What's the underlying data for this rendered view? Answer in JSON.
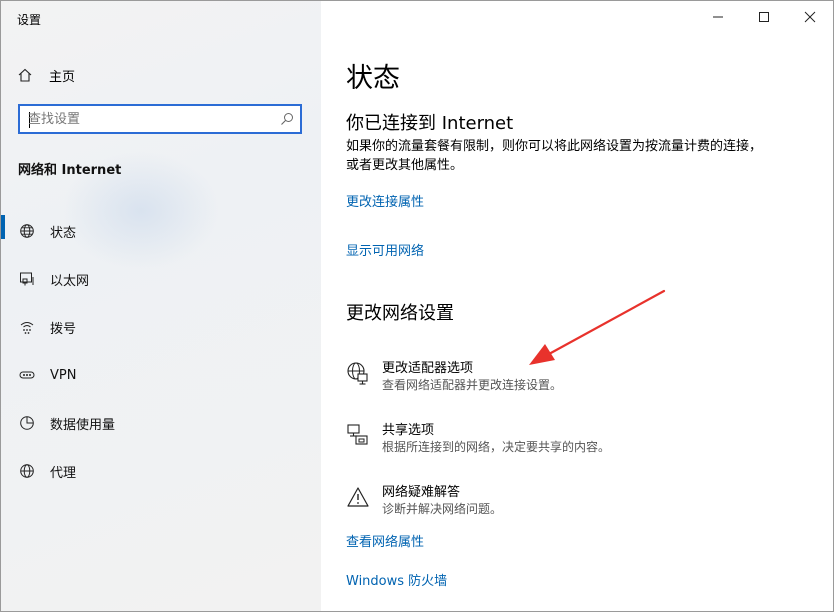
{
  "window": {
    "title": "设置"
  },
  "sidebar": {
    "home_label": "主页",
    "search_placeholder": "查找设置",
    "section_label": "网络和 Internet",
    "items": [
      {
        "label": "状态",
        "icon": "globe-icon",
        "active": true
      },
      {
        "label": "以太网",
        "icon": "ethernet-icon"
      },
      {
        "label": "拨号",
        "icon": "dialup-icon"
      },
      {
        "label": "VPN",
        "icon": "vpn-icon"
      },
      {
        "label": "数据使用量",
        "icon": "data-usage-icon"
      },
      {
        "label": "代理",
        "icon": "proxy-globe-icon"
      }
    ]
  },
  "main": {
    "title": "状态",
    "connected_heading": "你已连接到 Internet",
    "connected_desc": "如果你的流量套餐有限制，则你可以将此网络设置为按流量计费的连接，或者更改其他属性。",
    "link_change_props": "更改连接属性",
    "link_show_networks": "显示可用网络",
    "change_heading": "更改网络设置",
    "options": [
      {
        "title": "更改适配器选项",
        "subtitle": "查看网络适配器并更改连接设置。",
        "icon": "adapter-icon"
      },
      {
        "title": "共享选项",
        "subtitle": "根据所连接到的网络，决定要共享的内容。",
        "icon": "sharing-icon"
      },
      {
        "title": "网络疑难解答",
        "subtitle": "诊断并解决网络问题。",
        "icon": "warning-icon"
      }
    ],
    "link_view_props": "查看网络属性",
    "link_firewall": "Windows 防火墙"
  },
  "colors": {
    "accent": "#0063b1",
    "search_border": "#2b6cd5",
    "annotation_arrow": "#e8322c"
  }
}
